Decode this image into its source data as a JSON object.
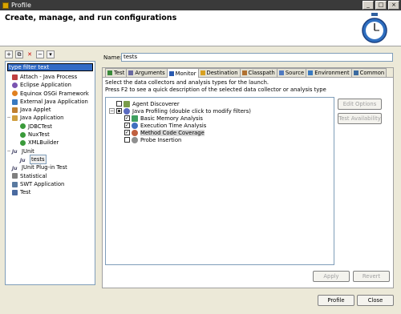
{
  "window": {
    "title": "Profile"
  },
  "header": {
    "title": "Create, manage, and run configurations"
  },
  "filter": {
    "placeholder": "type filter text"
  },
  "configs": [
    {
      "label": "Attach - Java Process",
      "icon": "attach-icon",
      "level": 0,
      "toggle": ""
    },
    {
      "label": "Eclipse Application",
      "icon": "eclipse-icon",
      "level": 0,
      "toggle": ""
    },
    {
      "label": "Equinox OSGi Framework",
      "icon": "equinox-icon",
      "level": 0,
      "toggle": ""
    },
    {
      "label": "External Java Application",
      "icon": "external-java-icon",
      "level": 0,
      "toggle": ""
    },
    {
      "label": "Java Applet",
      "icon": "applet-icon",
      "level": 0,
      "toggle": ""
    },
    {
      "label": "Java Application",
      "icon": "java-app-icon",
      "level": 0,
      "toggle": "−"
    },
    {
      "label": "JDBCTest",
      "icon": "class-icon",
      "level": 1,
      "toggle": ""
    },
    {
      "label": "NuxTest",
      "icon": "class-icon",
      "level": 1,
      "toggle": ""
    },
    {
      "label": "XMLBuilder",
      "icon": "class-icon",
      "level": 1,
      "toggle": ""
    },
    {
      "label": "JUnit",
      "icon": "junit-icon",
      "level": 0,
      "toggle": "−"
    },
    {
      "label": "tests",
      "icon": "junit-icon",
      "level": 1,
      "toggle": "",
      "selected": true
    },
    {
      "label": "JUnit Plug-in Test",
      "icon": "junit-icon",
      "level": 0,
      "toggle": ""
    },
    {
      "label": "Statistical",
      "icon": "statistical-icon",
      "level": 0,
      "toggle": ""
    },
    {
      "label": "SWT Application",
      "icon": "swt-icon",
      "level": 0,
      "toggle": ""
    },
    {
      "label": "Test",
      "icon": "test-icon",
      "level": 0,
      "toggle": ""
    }
  ],
  "name_label": "Name:",
  "name_value": "tests",
  "tabs": [
    {
      "label": "Test",
      "icon": "test-tab-icon",
      "active": false
    },
    {
      "label": "Arguments",
      "icon": "arguments-icon",
      "active": false
    },
    {
      "label": "Monitor",
      "icon": "monitor-icon",
      "active": true
    },
    {
      "label": "Destination",
      "icon": "folder-icon",
      "active": false
    },
    {
      "label": "Classpath",
      "icon": "classpath-icon",
      "active": false
    },
    {
      "label": "Source",
      "icon": "source-icon",
      "active": false
    },
    {
      "label": "Environment",
      "icon": "environment-icon",
      "active": false
    },
    {
      "label": "Common",
      "icon": "common-icon",
      "active": false
    }
  ],
  "description": {
    "line1": "Select the data collectors and analysis types for the launch.",
    "line2": "Press F2 to see a quick description of the selected data collector or analysis type"
  },
  "collectors": [
    {
      "label": "Agent Discoverer",
      "checked": false,
      "expandable": false,
      "level": 0,
      "icon": "agent-icon"
    },
    {
      "label": "Java Profiling (double click to modify filters)",
      "checked": "partial",
      "expandable": true,
      "level": 0,
      "icon": "java-profiling-icon"
    },
    {
      "label": "Basic Memory Analysis",
      "checked": true,
      "expandable": false,
      "level": 1,
      "icon": "memory-icon"
    },
    {
      "label": "Execution Time Analysis",
      "checked": true,
      "expandable": false,
      "level": 1,
      "icon": "time-icon"
    },
    {
      "label": "Method Code Coverage",
      "checked": true,
      "expandable": false,
      "level": 1,
      "icon": "coverage-icon",
      "selected": true
    },
    {
      "label": "Probe Insertion",
      "checked": false,
      "expandable": false,
      "level": 1,
      "icon": "probe-icon"
    }
  ],
  "buttons": {
    "edit_options": "Edit Options",
    "test_availability": "Test Availability",
    "apply": "Apply",
    "revert": "Revert",
    "profile": "Profile",
    "close": "Close"
  },
  "colors": {
    "selection": "#316ac5",
    "titlebar": "#3a3a3a",
    "accent": "#1c5fb0"
  }
}
